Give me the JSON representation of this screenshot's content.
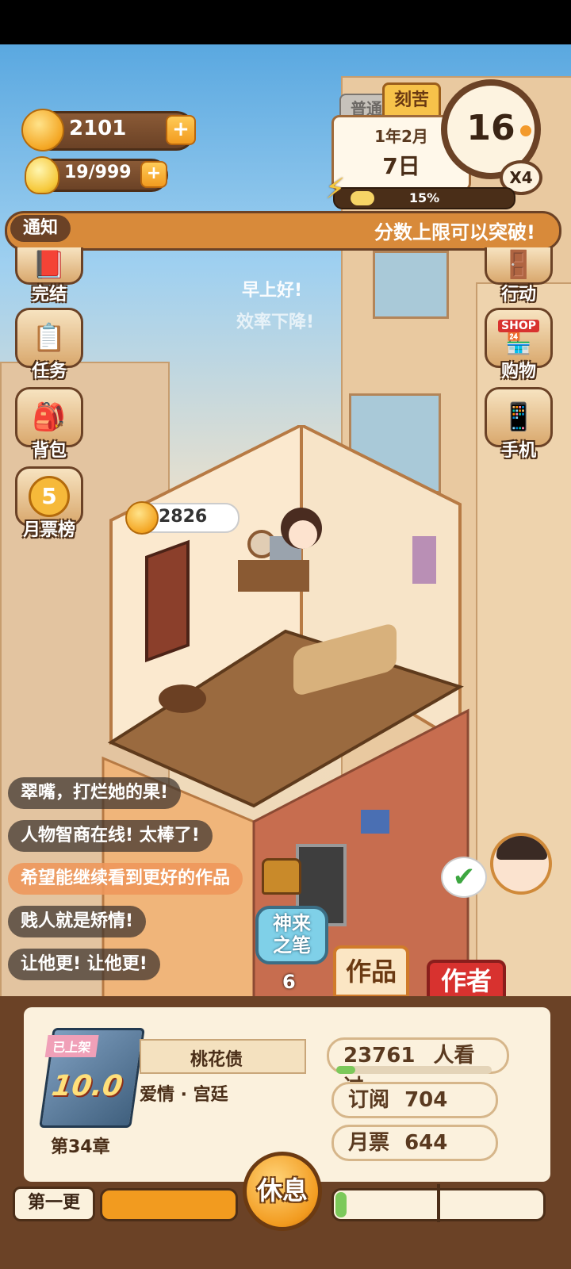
{
  "resources": {
    "coins": "2101",
    "energy": "19/999"
  },
  "calendar": {
    "tab_normal": "普通",
    "tab_hard": "刻苦",
    "year_month": "1年2月",
    "day": "7日",
    "hour": "16",
    "speed": "X4",
    "progress_label": "15%",
    "progress_value": 0.15
  },
  "notice": {
    "label": "通知",
    "text": "分数上限可以突破!"
  },
  "floating_text": {
    "line1": "早上好!",
    "line2": "效率下降!"
  },
  "left_menu": [
    {
      "label": "完结",
      "icon": "book-icon"
    },
    {
      "label": "任务",
      "icon": "checklist-icon"
    },
    {
      "label": "背包",
      "icon": "backpack-icon"
    },
    {
      "label": "月票榜",
      "icon": "ticket-icon",
      "badge": "5"
    }
  ],
  "right_menu": [
    {
      "label": "行动",
      "icon": "door-icon"
    },
    {
      "label": "购物",
      "icon": "shop-icon",
      "sign": "SHOP"
    },
    {
      "label": "手机",
      "icon": "phone-icon"
    }
  ],
  "room": {
    "coin_bubble": "2826"
  },
  "comments": [
    {
      "text": "翠嘴，打烂她的果!"
    },
    {
      "text": "人物智商在线! 太棒了!"
    },
    {
      "text": "希望能继续看到更好的作品"
    },
    {
      "text": "贱人就是矫情!"
    },
    {
      "text": "让他更! 让他更!"
    }
  ],
  "skill": {
    "label": "神来之笔",
    "count": "6"
  },
  "tabs": {
    "works": "作品",
    "author": "作者"
  },
  "book": {
    "status": "已上架",
    "score": "10.0",
    "title": "桃花债",
    "genre": "爱情 · 宫廷",
    "chapter": "第34章",
    "readers": "23761",
    "readers_suffix": "人看过",
    "readers_progress": 0.12,
    "subscriptions_label": "订阅",
    "subscriptions": "704",
    "monthly_tickets_label": "月票",
    "monthly_tickets": "644"
  },
  "bottom": {
    "update_label": "第一更",
    "rest_button": "休息"
  },
  "colors": {
    "accent_orange": "#f29b1f",
    "panel_brown": "#6b4226",
    "author_red": "#d8322f",
    "green_progress": "#7cc95a"
  }
}
